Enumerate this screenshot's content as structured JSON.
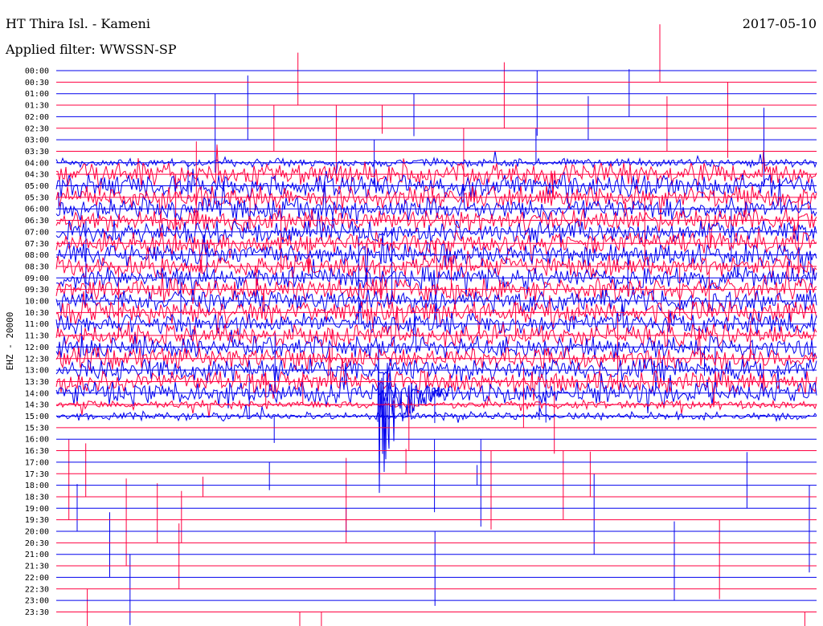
{
  "header": {
    "station": "HT Thira Isl. - Kameni",
    "date": "2017-05-10",
    "filter": "Applied filter: WWSSN-SP"
  },
  "channel_label": "EHZ - 20000",
  "colors": {
    "trace_a": "#0000ee",
    "trace_b": "#ff0040",
    "background": "#ffffff",
    "text": "#000000"
  },
  "chart_data": {
    "type": "line",
    "subtype": "helicorder",
    "y_tick_labels": [
      "00:00",
      "00:30",
      "01:00",
      "01:30",
      "02:00",
      "02:30",
      "03:00",
      "03:30",
      "04:00",
      "04:30",
      "05:00",
      "05:30",
      "06:00",
      "06:30",
      "07:00",
      "07:30",
      "08:00",
      "08:30",
      "09:00",
      "09:30",
      "10:00",
      "10:30",
      "11:00",
      "11:30",
      "12:00",
      "12:30",
      "13:00",
      "13:30",
      "14:00",
      "14:30",
      "15:00",
      "15:30",
      "16:00",
      "16:30",
      "17:00",
      "17:30",
      "18:00",
      "18:30",
      "19:00",
      "19:30",
      "20:00",
      "20:30",
      "21:00",
      "21:30",
      "22:00",
      "22:30",
      "23:00",
      "23:30"
    ],
    "ylabel": "EHZ - 20000",
    "row_minutes": 30,
    "row_color_cycle": [
      "trace_a",
      "trace_b"
    ],
    "ylim_hours": [
      0,
      24
    ],
    "active_rows": {
      "noisy_window_hours": [
        4.0,
        15.0
      ],
      "strong_noise_hours": [
        4.5,
        14.0
      ]
    },
    "notable_events": [
      {
        "time_hours": 14.0,
        "note": "large-amplitude signal with decaying coda"
      }
    ]
  }
}
